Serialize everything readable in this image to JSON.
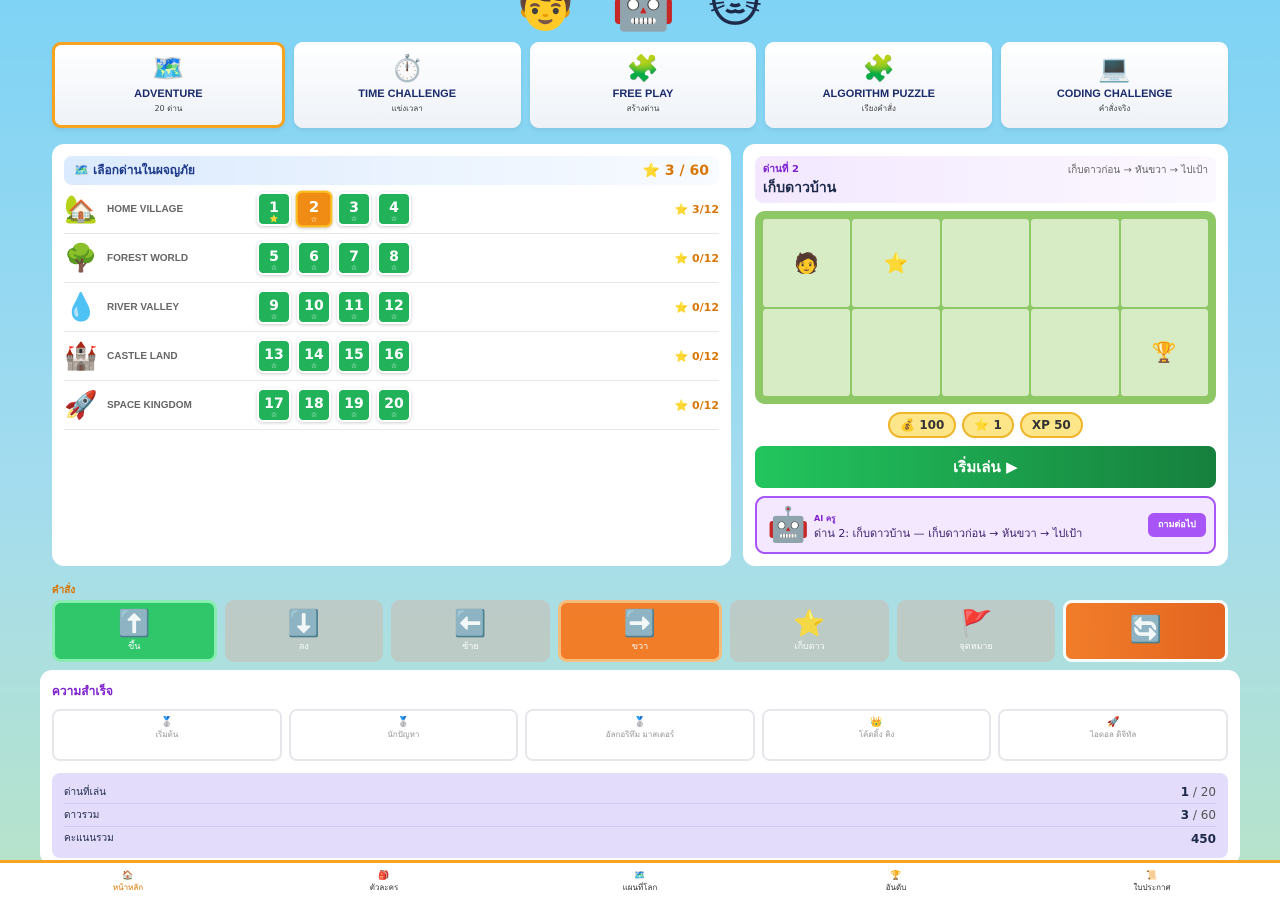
{
  "characters": [
    "👦",
    "🤖",
    "🐱"
  ],
  "modes": [
    {
      "icon": "🗺️",
      "title": "ADVENTURE",
      "sub": "20 ด่าน"
    },
    {
      "icon": "⏱️",
      "title": "TIME CHALLENGE",
      "sub": "แข่งเวลา"
    },
    {
      "icon": "🧩",
      "title": "FREE PLAY",
      "sub": "สร้างด่าน"
    },
    {
      "icon": "🧩",
      "title": "ALGORITHM PUZZLE",
      "sub": "เรียงคำสั่ง"
    },
    {
      "icon": "💻",
      "title": "CODING CHALLENGE",
      "sub": "คำสั่งจริง"
    }
  ],
  "level_select": {
    "title": "🗺️ เลือกด่านในผจญภัย",
    "stars": "⭐ 3 / 60"
  },
  "worlds": [
    {
      "icon": "🏡",
      "name": "HOME VILLAGE",
      "levels": [
        "1",
        "2",
        "3",
        "4"
      ],
      "stars_label": "⭐ 3/12"
    },
    {
      "icon": "🌳",
      "name": "FOREST WORLD",
      "levels": [
        "5",
        "6",
        "7",
        "8"
      ],
      "stars_label": "⭐ 0/12"
    },
    {
      "icon": "💧",
      "name": "RIVER VALLEY",
      "levels": [
        "9",
        "10",
        "11",
        "12"
      ],
      "stars_label": "⭐ 0/12"
    },
    {
      "icon": "🏰",
      "name": "CASTLE LAND",
      "levels": [
        "13",
        "14",
        "15",
        "16"
      ],
      "stars_label": "⭐ 0/12"
    },
    {
      "icon": "🚀",
      "name": "SPACE KINGDOM",
      "levels": [
        "17",
        "18",
        "19",
        "20"
      ],
      "stars_label": "⭐ 0/12"
    }
  ],
  "level_star_marks": {
    "earned": "⭐",
    "empty": "☆"
  },
  "current_level": {
    "label": "ด่านที่ 2",
    "name": "เก็บดาวบ้าน",
    "path": "เก็บดาวก่อน → หันขวา → ไปเป้า"
  },
  "board": {
    "player": "🧑",
    "star": "⭐",
    "goal": "🏆"
  },
  "rewards": [
    "💰 100",
    "⭐ 1",
    "XP 50"
  ],
  "play_label": "เริ่มเล่น ▶",
  "ai": {
    "icon": "🤖",
    "label": "AI ครู",
    "message": "ด่าน 2: เก็บดาวบ้าน — เก็บดาวก่อน → หันขวา → ไปเป้า",
    "ask": "ถามต่อไป"
  },
  "commands_label": "คำสั่ง",
  "commands": [
    {
      "icon": "⬆️",
      "label": "ขึ้น"
    },
    {
      "icon": "⬇️",
      "label": "ลง"
    },
    {
      "icon": "⬅️",
      "label": "ซ้าย"
    },
    {
      "icon": "➡️",
      "label": "ขวา"
    },
    {
      "icon": "⭐",
      "label": "เก็บดาว"
    },
    {
      "icon": "🚩",
      "label": "จุดหมาย"
    },
    {
      "icon": "🔄",
      "label": ""
    }
  ],
  "achievements": {
    "title": "ความสำเร็จ",
    "badges": [
      {
        "icon": "🥈",
        "label": "เริ่มต้น"
      },
      {
        "icon": "🥈",
        "label": "นักปัญหา"
      },
      {
        "icon": "🥈",
        "label": "อัลกอริทึม มาสเตอร์"
      },
      {
        "icon": "👑",
        "label": "โค้ดดิ้ง คิง"
      },
      {
        "icon": "🚀",
        "label": "ไอดอล ดิจิทัล"
      }
    ]
  },
  "stats": [
    {
      "label": "ด่านที่เล่น",
      "value": "1",
      "max": " / 20"
    },
    {
      "label": "ดาวรวม",
      "value": "3",
      "max": " / 60"
    },
    {
      "label": "คะแนนรวม",
      "value": "450",
      "max": ""
    }
  ],
  "nav": [
    {
      "icon": "🏠",
      "label": "หน้าหลัก"
    },
    {
      "icon": "🎒",
      "label": "ตัวละคร"
    },
    {
      "icon": "🗺️",
      "label": "แผนที่โลก"
    },
    {
      "icon": "🏆",
      "label": "อันดับ"
    },
    {
      "icon": "📜",
      "label": "ใบประกาศ"
    }
  ]
}
